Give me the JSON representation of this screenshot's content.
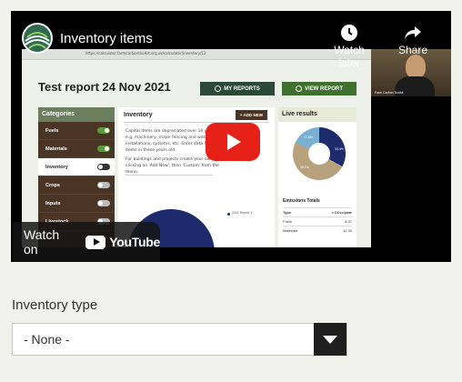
{
  "video": {
    "title": "Inventory items",
    "watch_later_label": "Watch later",
    "share_label": "Share",
    "watch_on_label": "Watch on",
    "youtube_label": "YouTube",
    "screen": {
      "url": "https://calculator.farmcarbontoolkit.org.uk/calculator/inventory/12",
      "report_title": "Test report 24 Nov 2021",
      "my_reports_label": "MY REPORTS",
      "view_report_label": "VIEW REPORT",
      "categories_heading": "Categories",
      "categories": [
        {
          "label": "Fuels",
          "on": true
        },
        {
          "label": "Materials",
          "on": true
        },
        {
          "label": "Inventory",
          "on": false
        },
        {
          "label": "Crops",
          "on": false
        },
        {
          "label": "Inputs",
          "on": false
        },
        {
          "label": "Livestock",
          "on": false
        }
      ],
      "inventory_heading": "Inventory",
      "add_new_label": "+ ADD NEW",
      "inventory_text_1": "Capital items are depreciated over 10 years, e.g. machinery, major fencing and water installations, systems, etc. Enter data for all items in these years old.",
      "inventory_text_2": "For buildings and projects create your own by clicking on 'Add New', then 'Custom' from the menu.",
      "legend_text": "2021 Report 1",
      "live_results_heading": "Live results",
      "pie_labels": [
        "33.4%",
        "49.1%",
        "17.5%"
      ],
      "pie_colors": [
        "#1d2a6b",
        "#b8a17d",
        "#7bb0d2"
      ],
      "emissions_title": "Emissions Totals",
      "emissions_header": {
        "type": "Type",
        "unit": "t CO₂e/year"
      },
      "emissions_rows": [
        {
          "type": "Fuels",
          "value": "8.37"
        },
        {
          "type": "Materials",
          "value": "12.30"
        }
      ],
      "webcam_name": "Farm Carbon Toolkit"
    }
  },
  "form": {
    "inventory_type_label": "Inventory type",
    "inventory_type_value": "- None -"
  },
  "colors": {
    "background": "#f1f1ec",
    "youtube_red": "#e62117",
    "dark_green": "#2a4a37",
    "brown": "#4a3423"
  }
}
